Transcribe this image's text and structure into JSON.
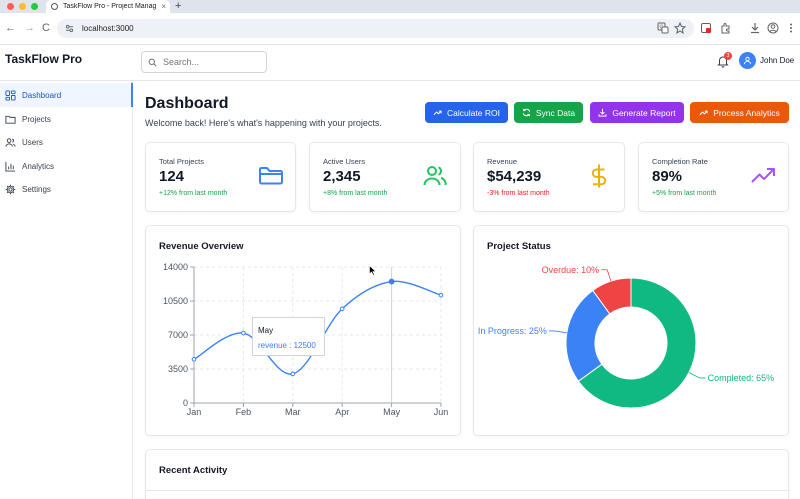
{
  "browser": {
    "tab_title": "TaskFlow Pro - Project Manag",
    "tab_close": "×",
    "new_tab": "+",
    "url": "localhost:3000",
    "nav_back": "←",
    "nav_forward": "→",
    "nav_reload": "C"
  },
  "app": {
    "brand": "TaskFlow Pro",
    "search_placeholder": "Search...",
    "notification_count": "3",
    "user_name": "John Doe"
  },
  "sidebar": {
    "items": [
      {
        "label": "Dashboard",
        "icon": "dashboard-icon",
        "active": true
      },
      {
        "label": "Projects",
        "icon": "folder-icon"
      },
      {
        "label": "Users",
        "icon": "users-icon"
      },
      {
        "label": "Analytics",
        "icon": "chart-icon"
      },
      {
        "label": "Settings",
        "icon": "gear-icon"
      }
    ]
  },
  "main": {
    "title": "Dashboard",
    "subtitle": "Welcome back! Here's what's happening with your projects.",
    "actions": [
      {
        "label": "Calculate ROI",
        "color": "#2563eb"
      },
      {
        "label": "Sync Data",
        "color": "#16a34a"
      },
      {
        "label": "Generate Report",
        "color": "#9333ea"
      },
      {
        "label": "Process Analytics",
        "color": "#ea580c"
      }
    ]
  },
  "stats": [
    {
      "label": "Total Projects",
      "value": "124",
      "change": "+12% from last month",
      "change_color": "#16a34a",
      "icon": "folder-icon",
      "icon_color": "#3b82f6"
    },
    {
      "label": "Active Users",
      "value": "2,345",
      "change": "+8% from last month",
      "change_color": "#16a34a",
      "icon": "users-icon",
      "icon_color": "#22c55e"
    },
    {
      "label": "Revenue",
      "value": "$54,239",
      "change": "-3% from last month",
      "change_color": "#dc2626",
      "icon": "dollar-icon",
      "icon_color": "#eab308"
    },
    {
      "label": "Completion Rate",
      "value": "89%",
      "change": "+5% from last month",
      "change_color": "#16a34a",
      "icon": "trending-up-icon",
      "icon_color": "#a855f7"
    }
  ],
  "revenue_card": {
    "title": "Revenue Overview",
    "tooltip_title": "May",
    "tooltip_value": "revenue : 12500"
  },
  "status_card": {
    "title": "Project Status"
  },
  "recent": {
    "title": "Recent Activity"
  },
  "chart_data": [
    {
      "type": "line",
      "title": "Revenue Overview",
      "categories": [
        "Jan",
        "Feb",
        "Mar",
        "Apr",
        "May",
        "Jun"
      ],
      "series": [
        {
          "name": "revenue",
          "values": [
            4500,
            7200,
            3000,
            9700,
            12500,
            11100
          ],
          "color": "#3b82f6"
        }
      ],
      "yticks": [
        "0",
        "3500",
        "7000",
        "10500",
        "14000"
      ],
      "ylim": [
        0,
        14000
      ],
      "grid": true
    },
    {
      "type": "pie",
      "title": "Project Status",
      "donut": true,
      "slices": [
        {
          "label": "Completed: 65%",
          "value": 65,
          "color": "#10b981"
        },
        {
          "label": "In Progress: 25%",
          "value": 25,
          "color": "#3b82f6"
        },
        {
          "label": "Overdue: 10%",
          "value": 10,
          "color": "#ef4444"
        }
      ]
    }
  ]
}
